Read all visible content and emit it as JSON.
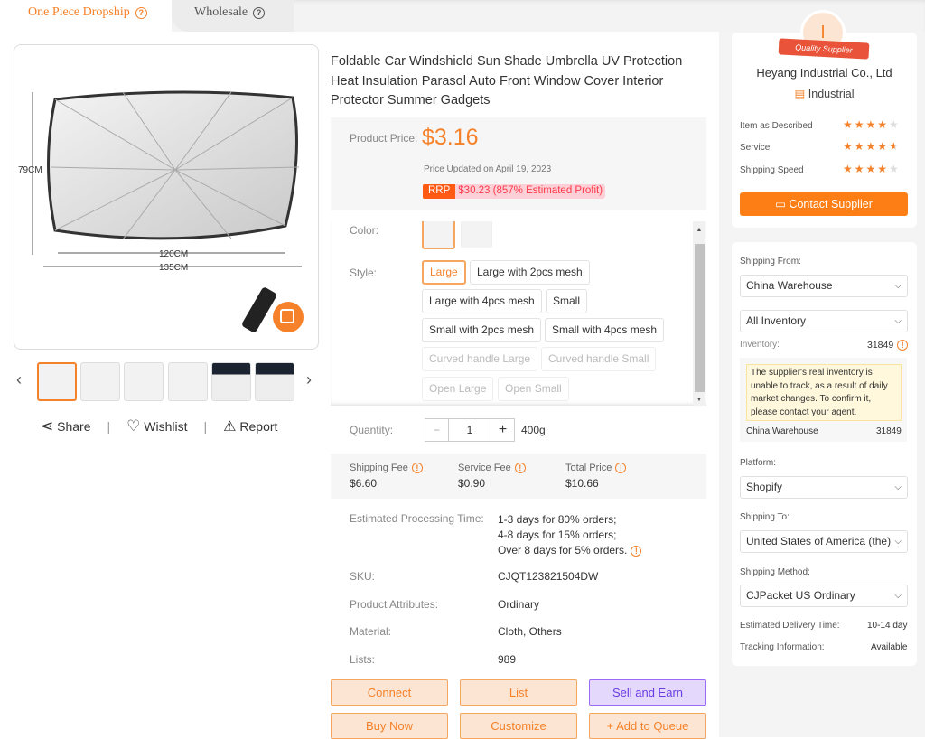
{
  "tabs": [
    {
      "label": "One Piece Dropship",
      "active": true
    },
    {
      "label": "Wholesale",
      "active": false
    }
  ],
  "gallery": {
    "dimensions": {
      "height": "79CM",
      "width1": "120CM",
      "width2": "135CM"
    },
    "thumbnail_count": 6,
    "selected_thumbnail": 0
  },
  "actions": {
    "share": "Share",
    "wishlist": "Wishlist",
    "report": "Report",
    "separator": "|"
  },
  "product": {
    "title": "Foldable Car Windshield Sun Shade Umbrella UV Protection Heat Insulation Parasol Auto Front Window Cover Interior Protector Summer Gadgets",
    "price_label": "Product Price:",
    "price": "$3.16",
    "price_updated": "Price Updated on April 19, 2023",
    "rrp_tag": "RRP",
    "rrp": "$30.23 (857% Estimated Profit)"
  },
  "variants": {
    "color_label": "Color:",
    "style_label": "Style:",
    "styles": [
      {
        "label": "Large",
        "state": "selected"
      },
      {
        "label": "Large with 2pcs mesh",
        "state": "normal"
      },
      {
        "label": "Large with 4pcs mesh",
        "state": "normal"
      },
      {
        "label": "Small",
        "state": "normal"
      },
      {
        "label": "Small with 2pcs mesh",
        "state": "normal"
      },
      {
        "label": "Small with 4pcs mesh",
        "state": "normal"
      },
      {
        "label": "Curved handle Large",
        "state": "disabled"
      },
      {
        "label": "Curved handle Small",
        "state": "disabled"
      },
      {
        "label": "Open Large",
        "state": "disabled"
      },
      {
        "label": "Open Small",
        "state": "disabled"
      }
    ]
  },
  "quantity": {
    "label": "Quantity:",
    "value": "1",
    "minus": "−",
    "plus": "+",
    "weight": "400g"
  },
  "fees": {
    "shipping_label": "Shipping Fee",
    "shipping": "$6.60",
    "service_label": "Service Fee",
    "service": "$0.90",
    "total_label": "Total Price",
    "total": "$10.66"
  },
  "details": {
    "processing_label": "Estimated Processing Time:",
    "processing": [
      "1-3 days for 80% orders;",
      "4-8 days for 15% orders;",
      "Over 8 days for 5% orders."
    ],
    "sku_label": "SKU:",
    "sku": "CJQT123821504DW",
    "attr_label": "Product Attributes:",
    "attr": "Ordinary",
    "material_label": "Material:",
    "material": "Cloth, Others",
    "lists_label": "Lists:",
    "lists": "989"
  },
  "buttons": {
    "connect": "Connect",
    "list": "List",
    "sell": "Sell and Earn",
    "buy": "Buy Now",
    "customize": "Customize",
    "queue": "+ Add to Queue"
  },
  "supplier": {
    "initial": "I",
    "badge": "Quality Supplier",
    "name": "Heyang Industrial Co., Ltd",
    "category": "Industrial",
    "ratings": [
      {
        "label": "Item as Described",
        "stars": 4
      },
      {
        "label": "Service",
        "stars": 4.5
      },
      {
        "label": "Shipping Speed",
        "stars": 4
      }
    ],
    "contact": "Contact Supplier"
  },
  "shipping": {
    "from_label": "Shipping From:",
    "from": "China Warehouse",
    "inventory_filter": "All Inventory",
    "inventory_label": "Inventory:",
    "inventory": "31849",
    "tooltip": "The supplier's real inventory is unable to track, as a result of daily market changes. To confirm it, please contact your agent.",
    "warehouse": "China Warehouse",
    "warehouse_qty": "31849",
    "platform_label": "Platform:",
    "platform": "Shopify",
    "to_label": "Shipping To:",
    "to": "United States of America (the)",
    "method_label": "Shipping Method:",
    "method": "CJPacket US Ordinary",
    "delivery_label": "Estimated Delivery Time:",
    "delivery": "10-14 day",
    "tracking_label": "Tracking Information:",
    "tracking": "Available"
  },
  "colors": {
    "accent": "#f5822a",
    "purple": "#6a3ee0",
    "rrp_red": "#fb3a4a"
  }
}
